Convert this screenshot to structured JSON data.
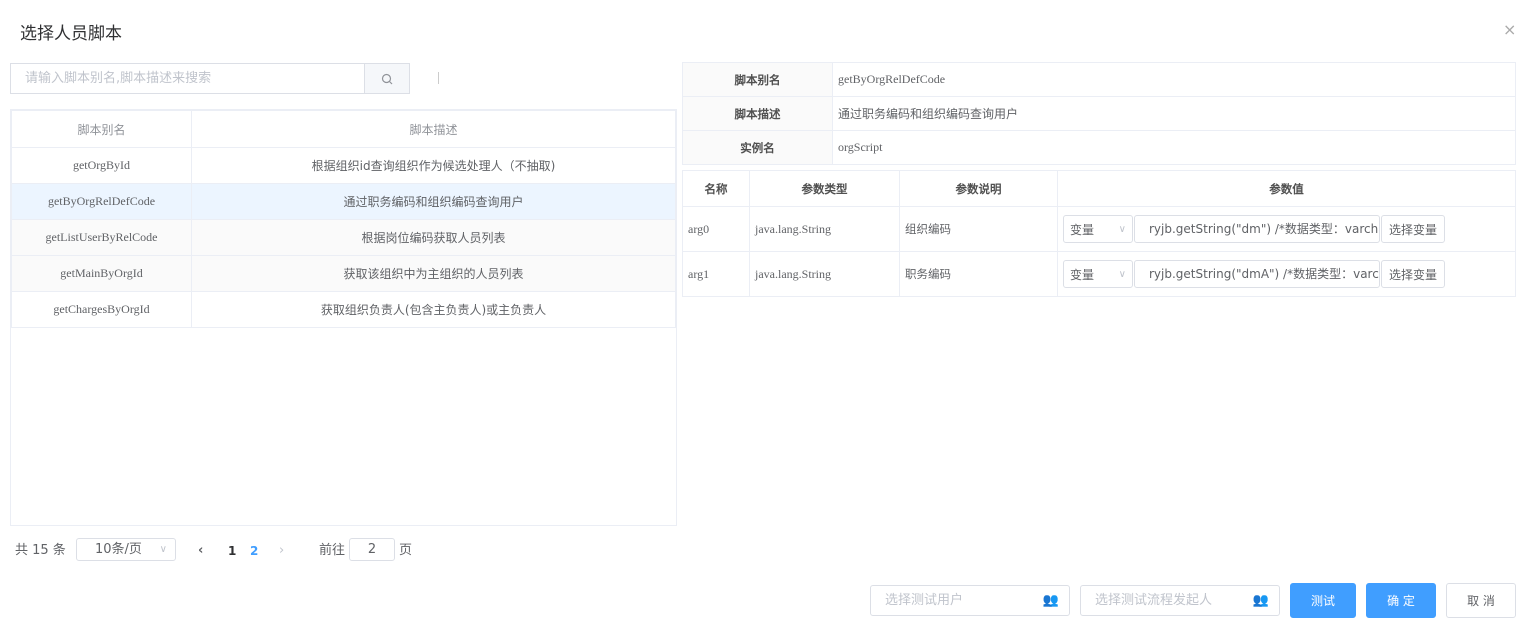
{
  "dialog": {
    "title": "选择人员脚本",
    "close": "×"
  },
  "search": {
    "placeholder": "请输入脚本别名,脚本描述来搜索"
  },
  "left_table": {
    "headers": [
      "脚本别名",
      "脚本描述"
    ],
    "rows": [
      {
        "alias": "getOrgById",
        "desc": "根据组织id查询组织作为候选处理人（不抽取)"
      },
      {
        "alias": "getByOrgRelDefCode",
        "desc": "通过职务编码和组织编码查询用户"
      },
      {
        "alias": "getListUserByRelCode",
        "desc": "根据岗位编码获取人员列表"
      },
      {
        "alias": "getMainByOrgId",
        "desc": "获取该组织中为主组织的人员列表"
      },
      {
        "alias": "getChargesByOrgId",
        "desc": "获取组织负责人(包含主负责人)或主负责人"
      }
    ]
  },
  "pagination": {
    "total": "共 15 条",
    "page_size": "10条/页",
    "pages": [
      "1",
      "2"
    ],
    "goto_label": "前往",
    "goto_value": "2",
    "page_suffix": "页"
  },
  "info": {
    "alias_label": "脚本别名",
    "alias": "getByOrgRelDefCode",
    "desc_label": "脚本描述",
    "desc": "通过职务编码和组织编码查询用户",
    "instance_label": "实例名",
    "instance": "orgScript"
  },
  "params": {
    "headers": [
      "名称",
      "参数类型",
      "参数说明",
      "参数值"
    ],
    "rows": [
      {
        "name": "arg0",
        "type": "java.lang.String",
        "desc": "组织编码",
        "mode": "变量",
        "value": "ryjb.getString(\"dm\") /*数据类型：varchar*/",
        "button": "选择变量"
      },
      {
        "name": "arg1",
        "type": "java.lang.String",
        "desc": "职务编码",
        "mode": "变量",
        "value": "ryjb.getString(\"dmA\") /*数据类型：varchar*/",
        "button": "选择变量"
      }
    ]
  },
  "footer": {
    "test_user_placeholder": "选择测试用户",
    "test_starter_placeholder": "选择测试流程发起人",
    "test": "测试",
    "ok": "确 定",
    "cancel": "取 消"
  }
}
